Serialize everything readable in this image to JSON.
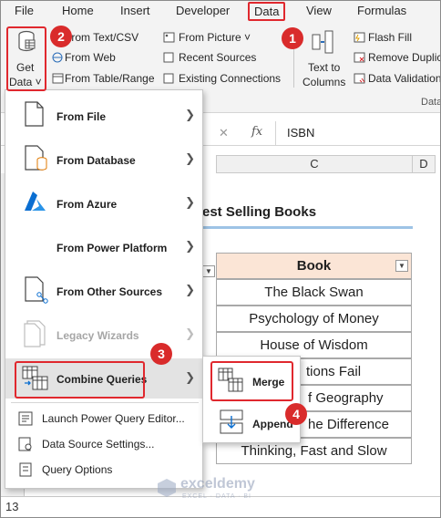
{
  "ribbon": {
    "tabs": [
      "File",
      "Home",
      "Insert",
      "Developer",
      "Data",
      "View",
      "Formulas"
    ],
    "get_data": {
      "line1": "Get",
      "line2": "Data ˅"
    },
    "group1": [
      "From Text/CSV",
      "From Web",
      "From Table/Range"
    ],
    "group2": [
      "From Picture ˅",
      "Recent Sources",
      "Existing Connections"
    ],
    "text_to_columns": {
      "line1": "Text to",
      "line2": "Columns"
    },
    "group3": [
      "Flash Fill",
      "Remove Duplic",
      "Data Validation"
    ],
    "group_label": "Data"
  },
  "formula_bar": {
    "fx": "fx",
    "value": "ISBN"
  },
  "columns": {
    "c": "C",
    "d": "D"
  },
  "sheet": {
    "title": "est Selling Books",
    "header": "Book",
    "rows": [
      "The Black Swan",
      "Psychology of Money",
      "House of Wisdom",
      "tions Fail",
      "f Geography",
      "he Difference",
      "Thinking, Fast and Slow"
    ],
    "row_number": "13"
  },
  "menu": {
    "items": [
      {
        "label": "From File",
        "icon": "file-icon"
      },
      {
        "label": "From Database",
        "icon": "database-icon"
      },
      {
        "label": "From Azure",
        "icon": "azure-icon"
      },
      {
        "label": "From Power Platform",
        "icon": ""
      },
      {
        "label": "From Other Sources",
        "icon": "other-sources-icon"
      },
      {
        "label": "Legacy Wizards",
        "icon": "legacy-icon"
      },
      {
        "label": "Combine Queries",
        "icon": "combine-icon"
      }
    ],
    "extras": [
      "Launch Power Query Editor...",
      "Data Source Settings...",
      "Query Options"
    ]
  },
  "submenu": {
    "merge": "Merge",
    "append": "Append"
  },
  "badges": [
    "1",
    "2",
    "3",
    "4"
  ],
  "watermark": {
    "name": "exceldemy",
    "tagline": "EXCEL · DATA · BI"
  },
  "colors": {
    "accent": "#e0282e",
    "header_fill": "#fbe5d6",
    "excel_green": "#217346"
  }
}
